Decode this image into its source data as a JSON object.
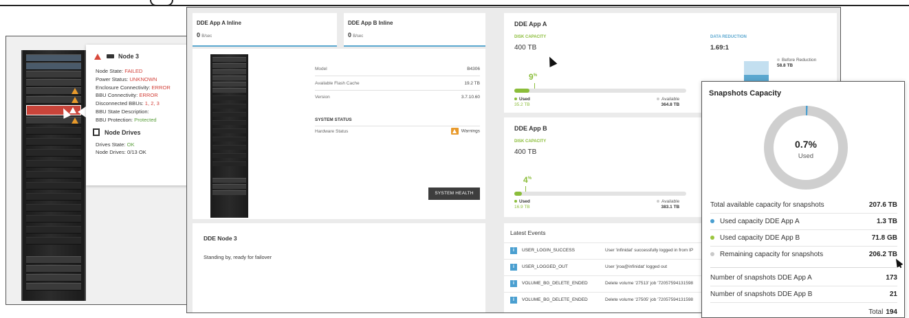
{
  "node_popup": {
    "title": "Node 3",
    "node_state_label": "Node State:",
    "node_state": "FAILED",
    "power_label": "Power Status:",
    "power_status": "UNKNOWN",
    "enclosure_label": "Enclosure Connectivity:",
    "enclosure_status": "ERROR",
    "bbu_conn_label": "BBU Connectivity:",
    "bbu_conn_status": "ERROR",
    "disconnected_label": "Disconnected BBUs:",
    "disconnected_bbus": "1, 2, 3",
    "bbu_desc_label": "BBU State Description:",
    "bbu_prot_label": "BBU Protection:",
    "bbu_protection": "Protected",
    "drives_title": "Node Drives",
    "drives_state_label": "Drives State:",
    "drives_state": "OK",
    "node_drives_label": "Node Drives: 0/13 OK"
  },
  "inline_a": {
    "title": "DDE App A Inline",
    "value": "0",
    "unit": "B/sec"
  },
  "inline_b": {
    "title": "DDE App B Inline",
    "value": "0",
    "unit": "B/sec"
  },
  "system": {
    "model_label": "Model",
    "model": "B4306",
    "cache_label": "Available Flash Cache",
    "cache": "19.2 TB",
    "version_label": "Version",
    "version": "3.7.10.60",
    "status_heading": "SYSTEM STATUS",
    "hardware_label": "Hardware Status",
    "hardware_status": "Warnings",
    "health_button": "SYSTEM HEALTH"
  },
  "node_card": {
    "title": "DDE Node 3",
    "desc": "Standing by, ready for failover"
  },
  "app_a": {
    "title": "DDE App A",
    "cap_label": "DISK CAPACITY",
    "cap_value": "400",
    "cap_unit": "TB",
    "percent": "9",
    "percent_sign": "%",
    "used_fraction": 0.088,
    "used_label": "Used",
    "used_value": "35.2 TB",
    "avail_label": "Available",
    "avail_value": "364.8 TB"
  },
  "data_reduction": {
    "label": "DATA REDUCTION",
    "ratio": "1.69:1",
    "before_label": "Before Reduction",
    "before_value": "58.8 TB"
  },
  "app_b": {
    "title": "DDE App B",
    "cap_label": "DISK CAPACITY",
    "cap_value": "400",
    "cap_unit": "TB",
    "percent": "4",
    "percent_sign": "%",
    "used_fraction": 0.042,
    "used_label": "Used",
    "used_value": "16.9 TB",
    "avail_label": "Available",
    "avail_value": "383.1 TB"
  },
  "events": {
    "title": "Latest Events",
    "rows": [
      {
        "type": "USER_LOGIN_SUCCESS",
        "msg": "User 'infinidat' successfully logged in from IP"
      },
      {
        "type": "USER_LOGGED_OUT",
        "msg": "User 'jroa@infinidat' logged out"
      },
      {
        "type": "VOLUME_BG_DELETE_ENDED",
        "msg": "Delete volume '27513' job '72057594131598"
      },
      {
        "type": "VOLUME_BG_DELETE_ENDED",
        "msg": "Delete volume '27505' job '72057594131598"
      }
    ]
  },
  "snapshots": {
    "title": "Snapshots Capacity",
    "used_percent": "0.7%",
    "used_fraction": 0.007,
    "used_label": "Used",
    "colors": {
      "app_a": "#4a9fd0",
      "app_b": "#9bc53d",
      "remaining": "#c9c9c9"
    },
    "rows": [
      {
        "label": "Total available capacity for snapshots",
        "value": "207.6 TB"
      },
      {
        "label": "Used capacity DDE App A",
        "value": "1.3 TB"
      },
      {
        "label": "Used capacity DDE App B",
        "value": "71.8 GB"
      },
      {
        "label": "Remaining capacity for snapshots",
        "value": "206.2 TB"
      },
      {
        "label": "Number of snapshots DDE App A",
        "value": "173"
      },
      {
        "label": "Number of snapshots DDE App B",
        "value": "21"
      }
    ],
    "total_label": "Total",
    "total_value": "194"
  }
}
